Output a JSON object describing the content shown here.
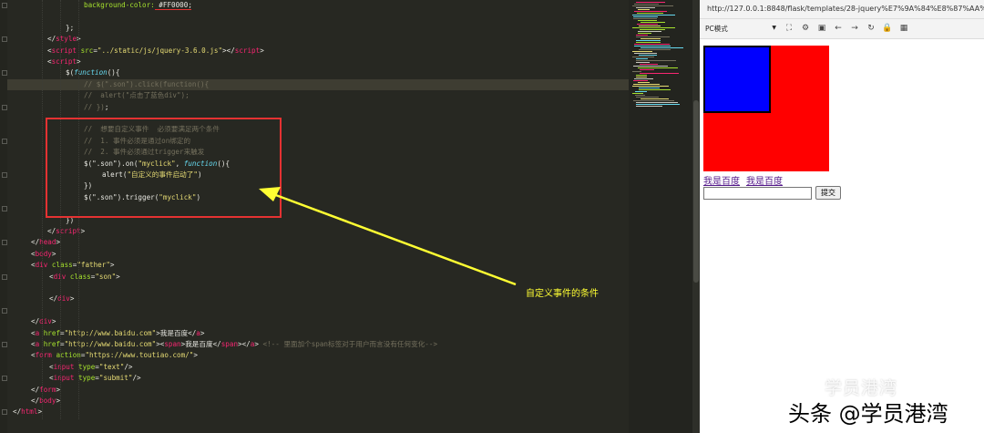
{
  "editor": {
    "lines": [
      {
        "tokens": [
          [
            "attr",
            "background-color: "
          ],
          [
            "plain",
            "#FF0000"
          ],
          [
            "plain",
            ";"
          ]
        ],
        "indent": 84
      },
      {
        "tokens": [],
        "indent": 0
      },
      {
        "tokens": [
          [
            "plain",
            "};"
          ]
        ],
        "indent": 64
      },
      {
        "tokens": [
          [
            "plain",
            "</"
          ],
          [
            "tag",
            "style"
          ],
          [
            "plain",
            ">"
          ]
        ],
        "indent": 44
      },
      {
        "tokens": [
          [
            "plain",
            "<"
          ],
          [
            "tag",
            "script"
          ],
          [
            "attr",
            " src"
          ],
          [
            "plain",
            "="
          ],
          [
            "str",
            "\"../static/js/jquery-3.6.0.js\""
          ],
          [
            "plain",
            "></"
          ],
          [
            "tag",
            "script"
          ],
          [
            "plain",
            ">"
          ]
        ],
        "indent": 44
      },
      {
        "tokens": [
          [
            "plain",
            "<"
          ],
          [
            "tag",
            "script"
          ],
          [
            "plain",
            ">"
          ]
        ],
        "indent": 44
      },
      {
        "tokens": [
          [
            "plain",
            "$("
          ],
          [
            "kw",
            "function"
          ],
          [
            "plain",
            "(){"
          ]
        ],
        "indent": 64
      },
      {
        "tokens": [
          [
            "cmt",
            "// $(\".son\").click(function(){"
          ]
        ],
        "indent": 84
      },
      {
        "tokens": [
          [
            "cmt",
            "//  alert(\"点击了蓝色div\");"
          ]
        ],
        "indent": 84
      },
      {
        "tokens": [
          [
            "cmt",
            "// })"
          ],
          [
            "plain",
            ";"
          ]
        ],
        "indent": 84
      },
      {
        "tokens": [],
        "indent": 0
      },
      {
        "tokens": [
          [
            "cmt",
            "//  想要自定义事件  必须要满足两个条件"
          ]
        ],
        "indent": 84
      },
      {
        "tokens": [
          [
            "cmt",
            "//  1. 事件必须是通过on绑定的"
          ]
        ],
        "indent": 84
      },
      {
        "tokens": [
          [
            "cmt",
            "//  2. 事件必须通过trigger来触发"
          ]
        ],
        "indent": 84
      },
      {
        "tokens": [
          [
            "plain",
            "$(\".son\").on("
          ],
          [
            "str",
            "\"myclick\""
          ],
          [
            "plain",
            ", "
          ],
          [
            "kw",
            "function"
          ],
          [
            "plain",
            "(){"
          ]
        ],
        "indent": 84
      },
      {
        "tokens": [
          [
            "plain",
            "alert("
          ],
          [
            "str",
            "\"自定义的事件启动了\""
          ],
          [
            "plain",
            ")"
          ]
        ],
        "indent": 104
      },
      {
        "tokens": [
          [
            "plain",
            "})"
          ]
        ],
        "indent": 84
      },
      {
        "tokens": [
          [
            "plain",
            "$(\".son\").trigger("
          ],
          [
            "str",
            "\"myclick\""
          ],
          [
            "plain",
            ")"
          ]
        ],
        "indent": 84
      },
      {
        "tokens": [],
        "indent": 0
      },
      {
        "tokens": [
          [
            "plain",
            "})"
          ]
        ],
        "indent": 64
      },
      {
        "tokens": [
          [
            "plain",
            "</"
          ],
          [
            "tag",
            "script"
          ],
          [
            "plain",
            ">"
          ]
        ],
        "indent": 44
      },
      {
        "tokens": [
          [
            "plain",
            "</"
          ],
          [
            "tag",
            "head"
          ],
          [
            "plain",
            ">"
          ]
        ],
        "indent": 26
      },
      {
        "tokens": [
          [
            "plain",
            "<"
          ],
          [
            "tag",
            "body"
          ],
          [
            "plain",
            ">"
          ]
        ],
        "indent": 26
      },
      {
        "tokens": [
          [
            "plain",
            "<"
          ],
          [
            "tag",
            "div"
          ],
          [
            "attr",
            " class"
          ],
          [
            "plain",
            "="
          ],
          [
            "str",
            "\"father\""
          ],
          [
            "plain",
            ">"
          ]
        ],
        "indent": 26
      },
      {
        "tokens": [
          [
            "plain",
            "<"
          ],
          [
            "tag",
            "div"
          ],
          [
            "attr",
            " class"
          ],
          [
            "plain",
            "="
          ],
          [
            "str",
            "\"son\""
          ],
          [
            "plain",
            ">"
          ]
        ],
        "indent": 46
      },
      {
        "tokens": [],
        "indent": 0
      },
      {
        "tokens": [
          [
            "plain",
            "</"
          ],
          [
            "tag",
            "div"
          ],
          [
            "plain",
            ">"
          ]
        ],
        "indent": 46
      },
      {
        "tokens": [],
        "indent": 0
      },
      {
        "tokens": [
          [
            "plain",
            "</"
          ],
          [
            "tag",
            "div"
          ],
          [
            "plain",
            ">"
          ]
        ],
        "indent": 26
      },
      {
        "tokens": [
          [
            "plain",
            "<"
          ],
          [
            "tag",
            "a"
          ],
          [
            "attr",
            " href"
          ],
          [
            "plain",
            "="
          ],
          [
            "str",
            "\"http://www.baidu.com\""
          ],
          [
            "plain",
            ">我是百度</"
          ],
          [
            "tag",
            "a"
          ],
          [
            "plain",
            ">"
          ]
        ],
        "indent": 26
      },
      {
        "tokens": [
          [
            "plain",
            "<"
          ],
          [
            "tag",
            "a"
          ],
          [
            "attr",
            " href"
          ],
          [
            "plain",
            "="
          ],
          [
            "str",
            "\"http://www.baidu.com\""
          ],
          [
            "plain",
            "><"
          ],
          [
            "tag",
            "span"
          ],
          [
            "plain",
            ">我是百度</"
          ],
          [
            "tag",
            "span"
          ],
          [
            "plain",
            "></"
          ],
          [
            "tag",
            "a"
          ],
          [
            "plain",
            ">"
          ],
          [
            "cmt",
            " <!-- 里面加个span标签对于用户而言没有任何变化-->"
          ]
        ],
        "indent": 26
      },
      {
        "tokens": [
          [
            "plain",
            "<"
          ],
          [
            "tag",
            "form"
          ],
          [
            "attr",
            " action"
          ],
          [
            "plain",
            "="
          ],
          [
            "str",
            "\"https://www.toutiao.com/\""
          ],
          [
            "plain",
            ">"
          ]
        ],
        "indent": 26
      },
      {
        "tokens": [
          [
            "plain",
            "<"
          ],
          [
            "tag",
            "input"
          ],
          [
            "attr",
            " type"
          ],
          [
            "plain",
            "="
          ],
          [
            "str",
            "\"text\""
          ],
          [
            "plain",
            "/>"
          ]
        ],
        "indent": 46
      },
      {
        "tokens": [
          [
            "plain",
            "<"
          ],
          [
            "tag",
            "input"
          ],
          [
            "attr",
            " type"
          ],
          [
            "plain",
            "="
          ],
          [
            "str",
            "\"submit\""
          ],
          [
            "plain",
            "/>"
          ]
        ],
        "indent": 46
      },
      {
        "tokens": [
          [
            "plain",
            "</"
          ],
          [
            "tag",
            "form"
          ],
          [
            "plain",
            ">"
          ]
        ],
        "indent": 26
      },
      {
        "tokens": [
          [
            "plain",
            "</"
          ],
          [
            "tag",
            "body"
          ],
          [
            "plain",
            ">"
          ]
        ],
        "indent": 26
      },
      {
        "tokens": [
          [
            "plain",
            "</"
          ],
          [
            "tag",
            "html"
          ],
          [
            "plain",
            ">"
          ]
        ],
        "indent": 6
      }
    ]
  },
  "annotation": {
    "callout": "自定义事件的条件",
    "box_color": "#e53232",
    "arrow_color": "#ffff33"
  },
  "browser": {
    "url": "http://127.0.0.1:8848/flask/templates/28-jquery%E7%9A%84%E8%87%AA%E5",
    "mode": "PC模式",
    "toolbar_icons": [
      "screenshot-icon",
      "settings-icon",
      "devtools-icon",
      "back-icon",
      "forward-icon",
      "refresh-icon",
      "lock-icon",
      "qrcode-icon"
    ],
    "father_color": "#ff0000",
    "son_color": "#0000ff",
    "link1": "我是百度",
    "link2": "我是百度",
    "submit_label": "提交"
  },
  "watermark": {
    "top": "学员港湾",
    "bottom": "头条 @学员港湾"
  }
}
